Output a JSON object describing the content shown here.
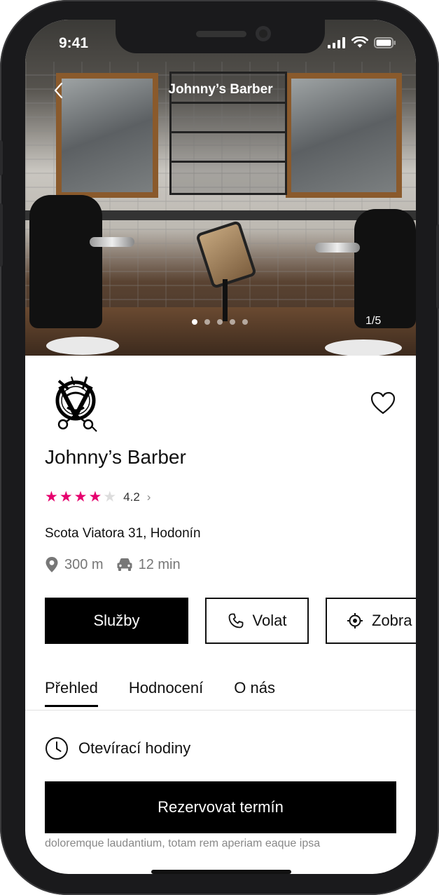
{
  "status_bar": {
    "time": "9:41"
  },
  "hero": {
    "title": "Johnny’s Barber",
    "image_counter": "1/5",
    "dot_count": 5,
    "active_dot": 0
  },
  "shop": {
    "name": "Johnny’s Barber",
    "rating_stars_filled": 4,
    "rating_stars_total": 5,
    "rating_value": "4.2",
    "address": "Scota Viatora 31, Hodonín",
    "distance": "300 m",
    "drive_time": "12 min"
  },
  "actions": {
    "services_label": "Služby",
    "call_label": "Volat",
    "show_label": "Zobra"
  },
  "tabs": [
    {
      "label": "Přehled",
      "active": true
    },
    {
      "label": "Hodnocení",
      "active": false
    },
    {
      "label": "O nás",
      "active": false
    }
  ],
  "overview": {
    "opening_hours_label": "Otevírací hodiny",
    "reserve_label": "Rezervovat termín",
    "description_fragment": "doloremque laudantium, totam rem aperiam eaque ipsa"
  },
  "colors": {
    "star_active": "#e6006e",
    "star_inactive": "#dddddd",
    "primary": "#000000"
  }
}
